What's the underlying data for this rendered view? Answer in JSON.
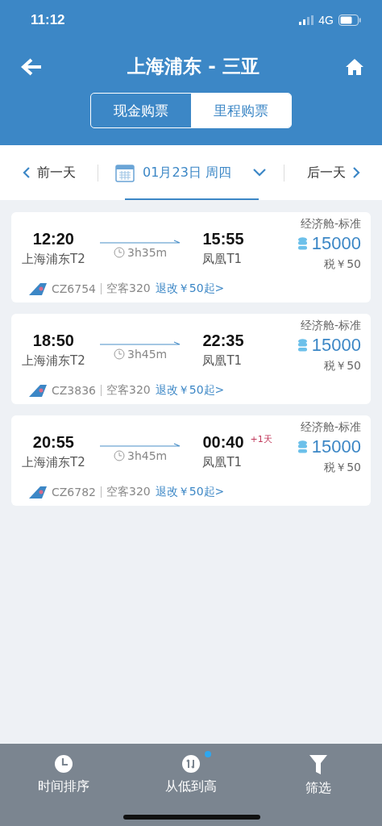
{
  "status_bar": {
    "time": "11:12",
    "network": "4G"
  },
  "header": {
    "title": "上海浦东 - 三亚"
  },
  "tabs": [
    {
      "label": "现金购票",
      "selected": false
    },
    {
      "label": "里程购票",
      "selected": true
    }
  ],
  "date_bar": {
    "prev": "前一天",
    "date": "01月23日 周四",
    "next": "后一天"
  },
  "flights": [
    {
      "dep_time": "12:20",
      "dep_airport": "上海浦东T2",
      "duration": "3h35m",
      "arr_time": "15:55",
      "arr_airport": "凤凰T1",
      "cabin": "经济舱-标准",
      "price": "15000",
      "tax": "税￥50",
      "flight_no": "CZ6754",
      "aircraft": "空客320",
      "refund": "退改￥50起>"
    },
    {
      "dep_time": "18:50",
      "dep_airport": "上海浦东T2",
      "duration": "3h45m",
      "arr_time": "22:35",
      "arr_airport": "凤凰T1",
      "cabin": "经济舱-标准",
      "price": "15000",
      "tax": "税￥50",
      "flight_no": "CZ3836",
      "aircraft": "空客320",
      "refund": "退改￥50起>"
    },
    {
      "dep_time": "20:55",
      "dep_airport": "上海浦东T2",
      "duration": "3h45m",
      "arr_time": "00:40",
      "next_day": "+1天",
      "arr_airport": "凤凰T1",
      "cabin": "经济舱-标准",
      "price": "15000",
      "tax": "税￥50",
      "flight_no": "CZ6782",
      "aircraft": "空客320",
      "refund": "退改￥50起>"
    }
  ],
  "bottom_bar": [
    {
      "kind": "time",
      "label": "时间排序",
      "dot": false
    },
    {
      "kind": "sort",
      "label": "从低到高",
      "dot": true
    },
    {
      "kind": "filter",
      "label": "筛选",
      "dot": false
    }
  ]
}
